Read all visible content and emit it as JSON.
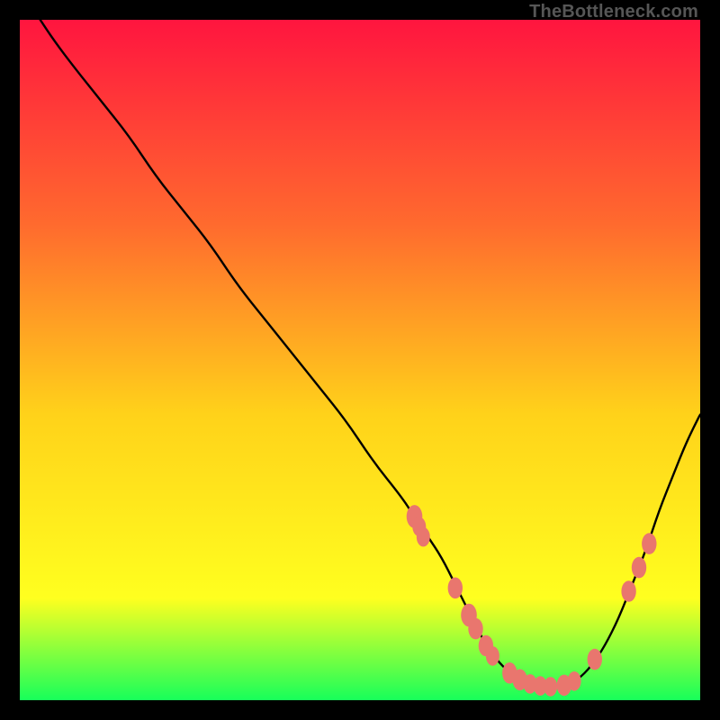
{
  "watermark": "TheBottleneck.com",
  "colors": {
    "gradient_top": "#ff153f",
    "gradient_mid1": "#ff6a2e",
    "gradient_mid2": "#ffd21a",
    "gradient_mid3": "#ffff1f",
    "gradient_bottom": "#17ff5a",
    "curve": "#000000",
    "marker_fill": "#e9766e",
    "marker_stroke": "#e9766e",
    "frame": "#000000"
  },
  "chart_data": {
    "type": "line",
    "title": "",
    "xlabel": "",
    "ylabel": "",
    "xlim": [
      0,
      100
    ],
    "ylim": [
      0,
      100
    ],
    "grid": false,
    "legend": false,
    "series": [
      {
        "name": "bottleneck-curve",
        "x": [
          3,
          5,
          8,
          12,
          16,
          20,
          24,
          28,
          32,
          36,
          40,
          44,
          48,
          52,
          56,
          58,
          60,
          62,
          64,
          66,
          68,
          70,
          72,
          74,
          76,
          78,
          80,
          82,
          84,
          86,
          88,
          90,
          92,
          94,
          96,
          98,
          100
        ],
        "y": [
          100,
          97,
          93,
          88,
          83,
          77,
          72,
          67,
          61,
          56,
          51,
          46,
          41,
          35,
          30,
          27,
          24,
          21,
          17,
          13,
          9,
          6,
          4,
          3,
          2,
          2,
          2,
          3,
          5,
          8,
          12,
          17,
          22,
          28,
          33,
          38,
          42
        ]
      }
    ],
    "markers": [
      {
        "x": 58,
        "y": 27,
        "r": 1.3
      },
      {
        "x": 58.7,
        "y": 25.5,
        "r": 1.1
      },
      {
        "x": 59.3,
        "y": 24,
        "r": 1.1
      },
      {
        "x": 64,
        "y": 16.5,
        "r": 1.2
      },
      {
        "x": 66,
        "y": 12.5,
        "r": 1.3
      },
      {
        "x": 67,
        "y": 10.5,
        "r": 1.2
      },
      {
        "x": 68.5,
        "y": 8,
        "r": 1.2
      },
      {
        "x": 69.5,
        "y": 6.5,
        "r": 1.1
      },
      {
        "x": 72,
        "y": 4,
        "r": 1.2
      },
      {
        "x": 73.5,
        "y": 3,
        "r": 1.2
      },
      {
        "x": 75,
        "y": 2.4,
        "r": 1.1
      },
      {
        "x": 76.5,
        "y": 2.1,
        "r": 1.1
      },
      {
        "x": 78,
        "y": 2,
        "r": 1.1
      },
      {
        "x": 80,
        "y": 2.2,
        "r": 1.2
      },
      {
        "x": 81.5,
        "y": 2.8,
        "r": 1.1
      },
      {
        "x": 84.5,
        "y": 6,
        "r": 1.2
      },
      {
        "x": 89.5,
        "y": 16,
        "r": 1.2
      },
      {
        "x": 91,
        "y": 19.5,
        "r": 1.2
      },
      {
        "x": 92.5,
        "y": 23,
        "r": 1.2
      }
    ]
  }
}
